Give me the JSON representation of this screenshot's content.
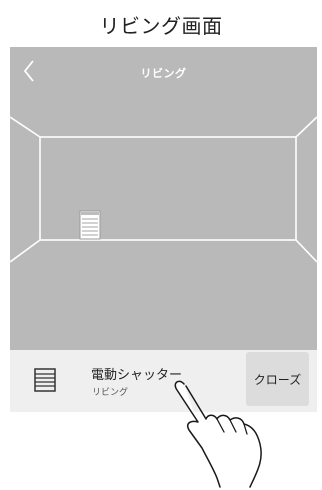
{
  "caption": "リビング画面",
  "header": {
    "title": "リビング",
    "back_icon": "chevron-left-icon"
  },
  "room": {
    "background": "#b9b9b9",
    "line_color": "#ffffff",
    "marker_icon": "shutter-icon"
  },
  "device": {
    "name": "電動シャッター",
    "room": "リビング",
    "icon": "shutter-icon",
    "action_label": "クローズ"
  },
  "overlay": {
    "icon": "pointing-hand-icon"
  }
}
